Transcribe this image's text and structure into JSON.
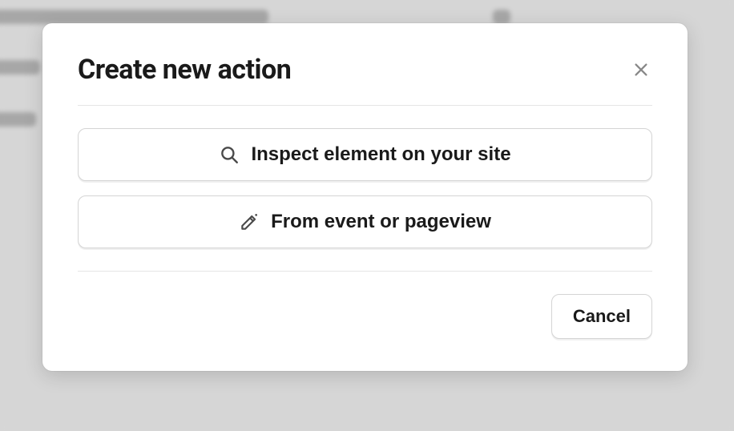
{
  "modal": {
    "title": "Create new action",
    "options": {
      "inspect_label": "Inspect element on your site",
      "event_label": "From event or pageview"
    },
    "cancel_label": "Cancel"
  }
}
